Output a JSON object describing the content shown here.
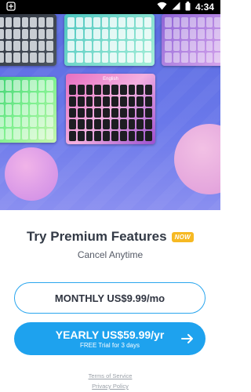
{
  "status_bar": {
    "time": "4:34",
    "icons": [
      "notification-icon",
      "wifi-icon",
      "signal-icon",
      "battery-icon"
    ]
  },
  "hero": {
    "preview_keyboard_label": "English",
    "colors": {
      "gradient_top": "#5a6be0",
      "gradient_bottom": "#8a8ff0"
    }
  },
  "headline": {
    "title": "Try Premium Features",
    "badge": "NOW",
    "subtitle": "Cancel Anytime"
  },
  "plans": {
    "monthly_label": "MONTHLY US$9.99/mo",
    "yearly_label": "YEARLY US$59.99/yr",
    "yearly_sub": "FREE Trial for 3 days"
  },
  "footer": {
    "terms": "Terms of Service",
    "privacy": "Privacy Policy"
  },
  "colors": {
    "accent": "#1ea2ee",
    "badge": "#f6b923",
    "title": "#333a46"
  }
}
